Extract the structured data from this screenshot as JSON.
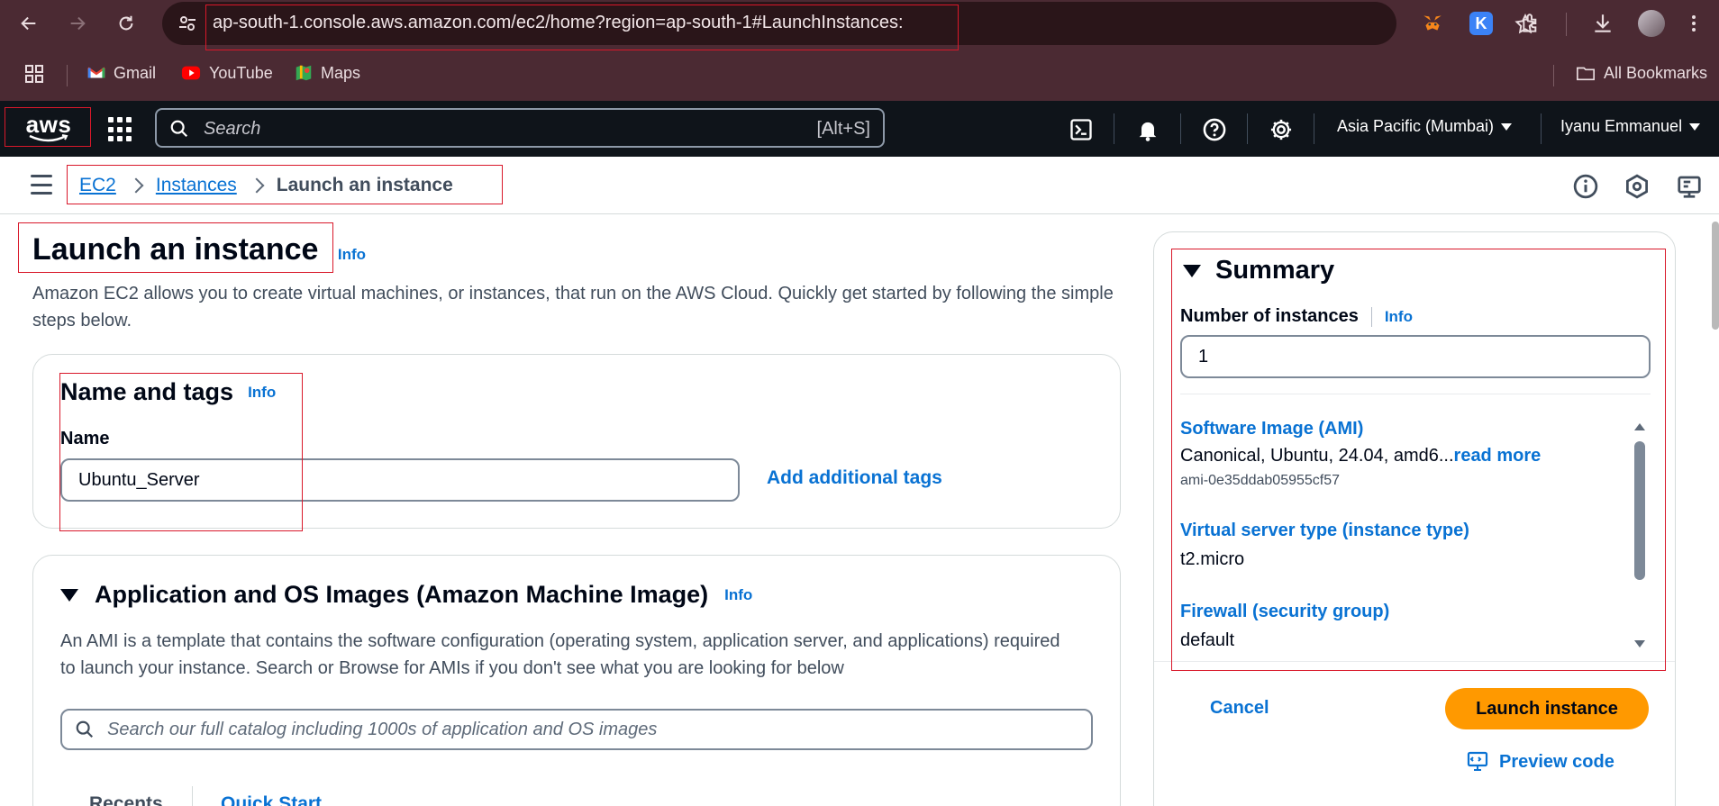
{
  "browser": {
    "url": "ap-south-1.console.aws.amazon.com/ec2/home?region=ap-south-1#LaunchInstances:",
    "bookmarks": [
      {
        "label": "Gmail",
        "icon": "gmail-icon"
      },
      {
        "label": "YouTube",
        "icon": "youtube-icon"
      },
      {
        "label": "Maps",
        "icon": "maps-icon"
      }
    ],
    "all_bookmarks_label": "All Bookmarks",
    "k_extension_letter": "K"
  },
  "aws_bar": {
    "logo": "aws",
    "search_placeholder": "Search",
    "search_shortcut": "[Alt+S]",
    "region": "Asia Pacific (Mumbai)",
    "user": "Iyanu Emmanuel"
  },
  "breadcrumb": {
    "items": [
      "EC2",
      "Instances"
    ],
    "current": "Launch an instance"
  },
  "page": {
    "title": "Launch an instance",
    "info_label": "Info",
    "description": "Amazon EC2 allows you to create virtual machines, or instances, that run on the AWS Cloud. Quickly get started by following the simple steps below."
  },
  "name_tags": {
    "heading": "Name and tags",
    "info_label": "Info",
    "name_label": "Name",
    "name_value": "Ubuntu_Server",
    "add_tags_label": "Add additional tags"
  },
  "ami": {
    "heading": "Application and OS Images (Amazon Machine Image)",
    "info_label": "Info",
    "description": "An AMI is a template that contains the software configuration (operating system, application server, and applications) required to launch your instance. Search or Browse for AMIs if you don't see what you are looking for below",
    "search_placeholder": "Search our full catalog including 1000s of application and OS images",
    "tabs": [
      "Recents",
      "Quick Start"
    ]
  },
  "summary": {
    "heading": "Summary",
    "num_instances_label": "Number of instances",
    "info_label": "Info",
    "num_instances_value": "1",
    "ami_label": "Software Image (AMI)",
    "ami_value": "Canonical, Ubuntu, 24.04, amd6...",
    "ami_read_more": "read more",
    "ami_id": "ami-0e35ddab05955cf57",
    "instance_type_label": "Virtual server type (instance type)",
    "instance_type_value": "t2.micro",
    "firewall_label": "Firewall (security group)",
    "firewall_value": "default",
    "cancel_label": "Cancel",
    "launch_label": "Launch instance",
    "preview_label": "Preview code"
  },
  "colors": {
    "aws_bar": "#0f141a",
    "link_blue": "#0972d3",
    "launch_orange": "#ff9900",
    "annotation_red": "#d9182a",
    "browser_chrome": "#4b2a33"
  }
}
